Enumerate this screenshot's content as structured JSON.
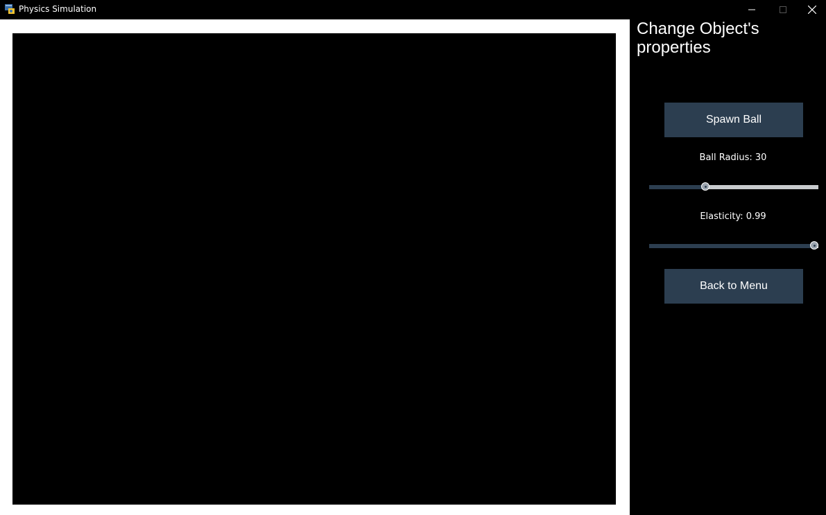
{
  "window": {
    "title": "Physics Simulation"
  },
  "panel": {
    "title": "Change Object's properties",
    "spawn_button": "Spawn Ball",
    "back_button": "Back to Menu",
    "radius_label": "Ball Radius: 30",
    "elasticity_label": "Elasticity: 0.99"
  },
  "sliders": {
    "radius_fraction": 0.33,
    "elasticity_fraction": 0.99
  },
  "colors": {
    "button_bg": "#2c3e50",
    "slider_track": "#c8cbce",
    "background": "#000000",
    "sim_border": "#ffffff"
  }
}
